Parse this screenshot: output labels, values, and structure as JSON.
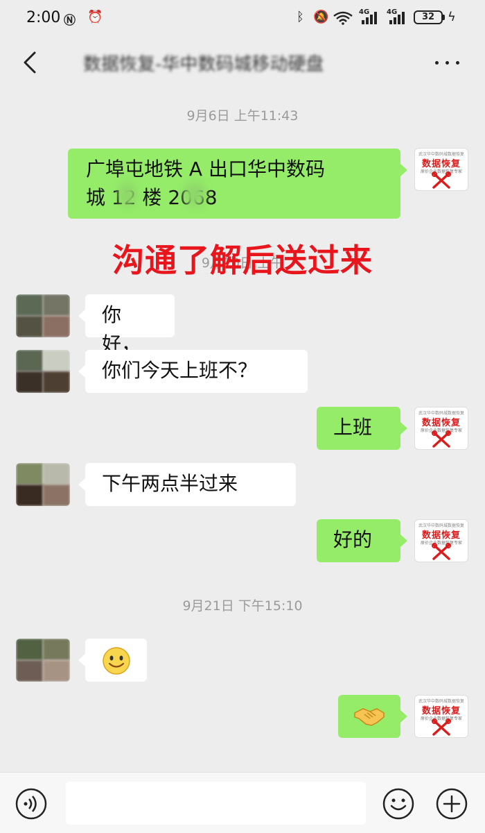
{
  "status_bar": {
    "time": "2:00",
    "signal_1": "4G",
    "signal_2": "4G",
    "battery": "32"
  },
  "header": {
    "title": "数据恢复-华中数码城移动硬盘"
  },
  "chat": {
    "timestamps": {
      "t1": "9月6日 上午11:43",
      "t2": "9月10日 上午",
      "t3": "9月21日 下午15:10"
    },
    "messages": {
      "m1": {
        "line1": "广埠屯地铁 A 出口华中数码",
        "line2": "城 12 楼 2068"
      },
      "m2": {
        "text": "你好，"
      },
      "m3": {
        "text": "你们今天上班不？"
      },
      "m4": {
        "text": "上班"
      },
      "m5": {
        "text": "下午两点半过来"
      },
      "m6": {
        "text": "好的"
      }
    },
    "self_avatar": {
      "brand": "数据恢复",
      "top_line": "武汉华中数码城数据恢复中心",
      "sub_line": "原价企业数据恢复专家"
    },
    "emojis": [
      "smile",
      "handshake"
    ]
  },
  "overlay_annotation": "沟通了解后送过来",
  "colors": {
    "background": "#ededed",
    "outgoing_bubble": "#95ec69",
    "incoming_bubble": "#ffffff",
    "overlay_text": "#e8161c",
    "brand_red": "#d91d1d"
  },
  "icons": {
    "back": "chevron-left-icon",
    "more": "more-icon",
    "voice": "voice-icon",
    "emoji": "emoji-icon",
    "add": "add-icon"
  }
}
